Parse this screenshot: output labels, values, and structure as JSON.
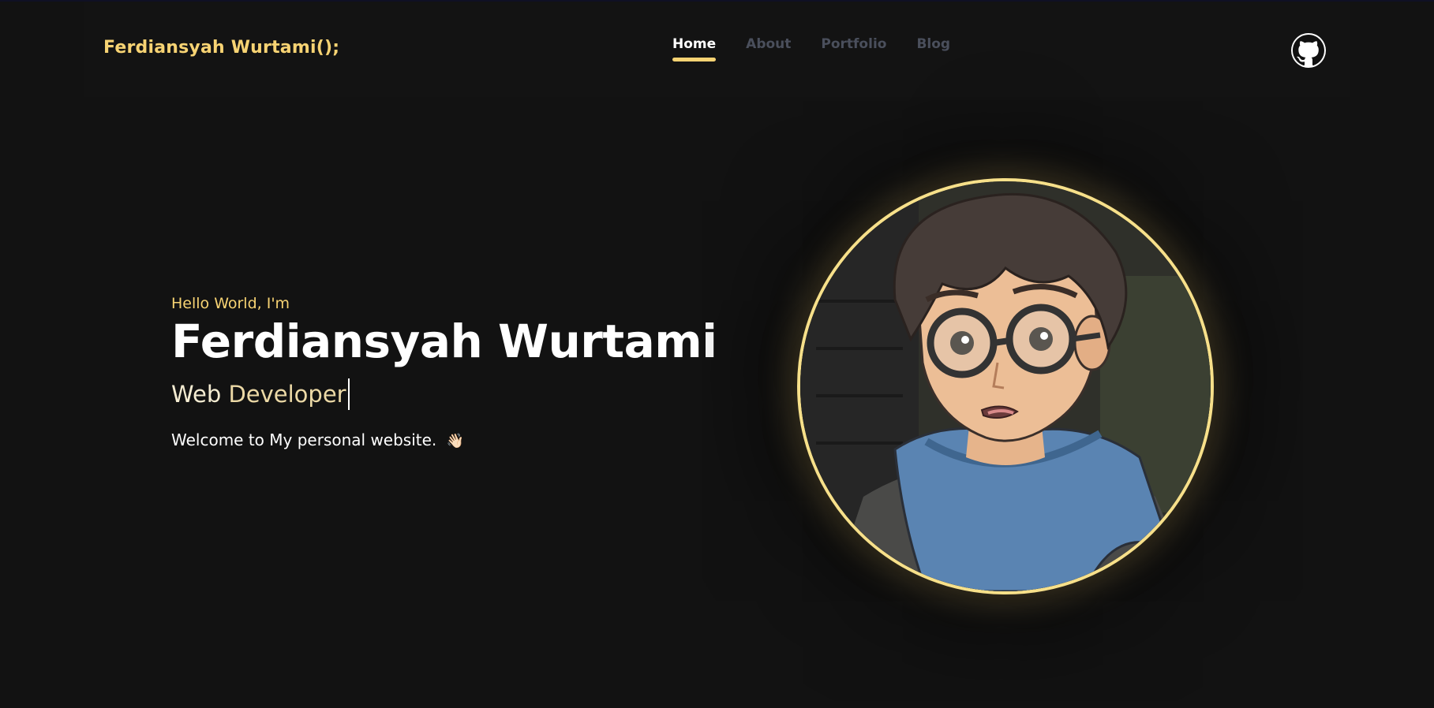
{
  "header": {
    "brand": "Ferdiansyah Wurtami();",
    "nav": [
      {
        "label": "Home",
        "active": true
      },
      {
        "label": "About",
        "active": false
      },
      {
        "label": "Portfolio",
        "active": false
      },
      {
        "label": "Blog",
        "active": false
      }
    ],
    "github_icon": "github-icon"
  },
  "hero": {
    "greeting": "Hello World, I'm",
    "name": "Ferdiansyah Wurtami",
    "role_word1": "Web",
    "role_word2": "Developer",
    "welcome": "Welcome to My personal website.",
    "wave_emoji": "👋🏻"
  },
  "avatar": {
    "icon": "profile-avatar-illustration"
  },
  "colors": {
    "background": "#121212",
    "accent": "#f7d373",
    "nav_inactive": "#4a4f5c",
    "text": "#ffffff"
  }
}
